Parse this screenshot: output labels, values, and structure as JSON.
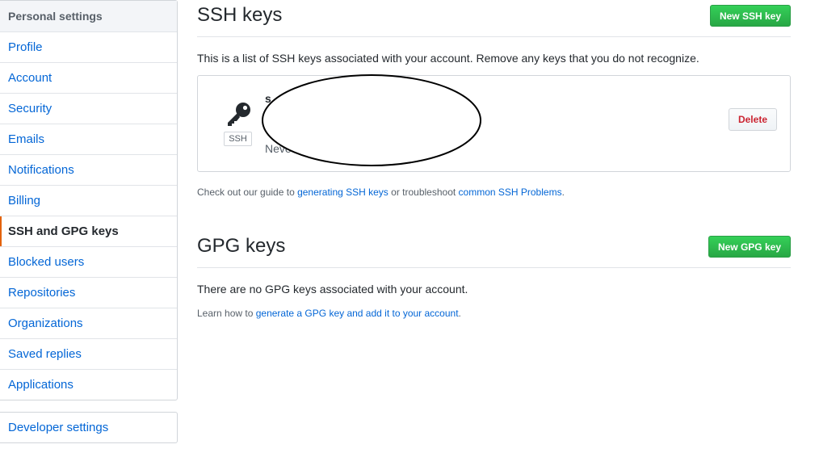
{
  "sidebar": {
    "heading": "Personal settings",
    "items": [
      {
        "label": "Profile"
      },
      {
        "label": "Account"
      },
      {
        "label": "Security"
      },
      {
        "label": "Emails"
      },
      {
        "label": "Notifications"
      },
      {
        "label": "Billing"
      },
      {
        "label": "SSH and GPG keys"
      },
      {
        "label": "Blocked users"
      },
      {
        "label": "Repositories"
      },
      {
        "label": "Organizations"
      },
      {
        "label": "Saved replies"
      },
      {
        "label": "Applications"
      }
    ],
    "developer_label": "Developer settings"
  },
  "ssh": {
    "title": "SSH keys",
    "new_button": "New SSH key",
    "description": "This is a list of SSH keys associated with your account. Remove any keys that you do not recognize.",
    "key": {
      "type_label": "SSH",
      "title_fragment": "s",
      "date_fragment": "Neve",
      "delete_label": "Delete"
    },
    "guide_prefix": "Check out our guide to ",
    "guide_link": "generating SSH keys",
    "guide_middle": " or troubleshoot ",
    "problems_link": "common SSH Problems",
    "guide_suffix": "."
  },
  "gpg": {
    "title": "GPG keys",
    "new_button": "New GPG key",
    "empty_text": "There are no GPG keys associated with your account.",
    "learn_prefix": "Learn how to ",
    "learn_link": "generate a GPG key and add it to your account",
    "learn_suffix": "."
  },
  "colors": {
    "link": "#0366d6",
    "primary_button": "#28a745",
    "danger": "#cb2431",
    "selected_marker": "#e36209"
  }
}
